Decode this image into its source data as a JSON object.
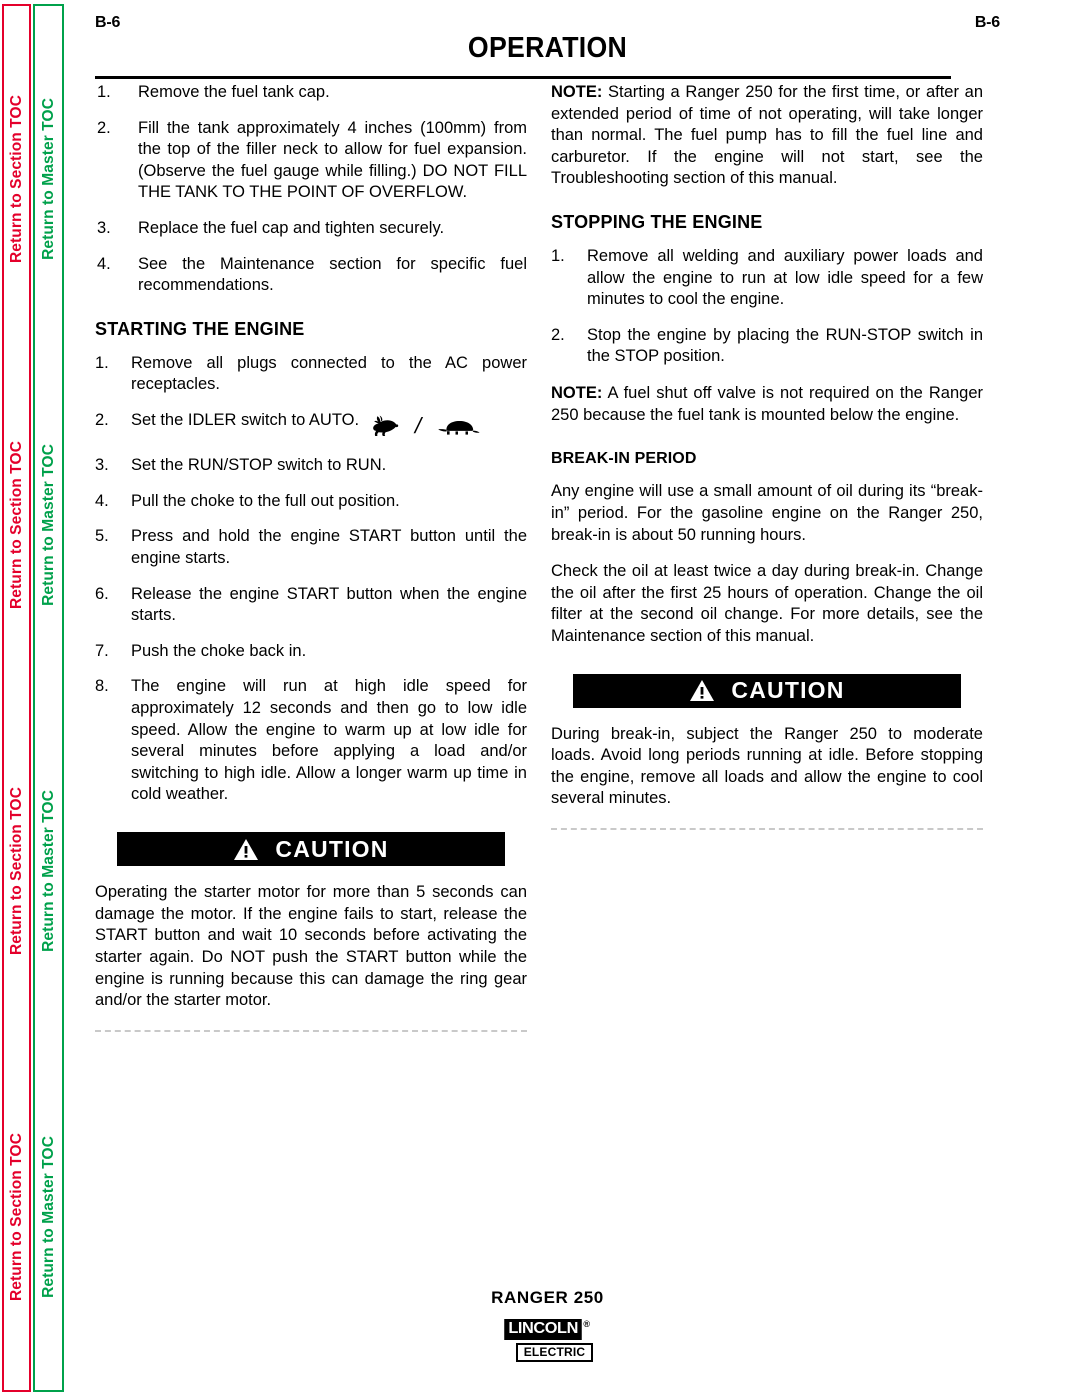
{
  "sidebar": {
    "section_toc_label": "Return to Section TOC",
    "master_toc_label": "Return to Master TOC",
    "repeat_count": 4,
    "section_color": "#e4002b",
    "master_color": "#00a14b"
  },
  "header": {
    "folio_left": "B-6",
    "folio_right": "B-6",
    "title": "OPERATION"
  },
  "left_column": {
    "fueling_steps": [
      {
        "num": "1.",
        "text": "Remove the fuel tank cap."
      },
      {
        "num": "2.",
        "text": "Fill the tank approximately 4 inches (100mm) from the top of the filler neck to allow for fuel expansion. (Observe the fuel gauge while filling.)  DO NOT FILL THE TANK TO THE POINT OF OVERFLOW."
      },
      {
        "num": "3.",
        "text": "Replace the fuel cap and tighten securely."
      },
      {
        "num": "4.",
        "text": "See the Maintenance  section for specific fuel recommendations."
      }
    ],
    "starting_heading": "STARTING THE ENGINE",
    "starting_steps": [
      {
        "num": "1.",
        "text": "Remove all plugs connected to the AC power receptacles."
      },
      {
        "num": "2.",
        "text": "Set the IDLER switch to AUTO.",
        "icons": [
          "rabbit-icon",
          "turtle-icon"
        ],
        "icon_separator": "/"
      },
      {
        "num": "3.",
        "text": "Set the RUN/STOP switch to RUN."
      },
      {
        "num": "4.",
        "text": "Pull the choke to the full out position."
      },
      {
        "num": "5.",
        "text": "Press and hold the engine START button until the engine starts."
      },
      {
        "num": "6.",
        "text": "Release the engine START button when the engine starts."
      },
      {
        "num": "7.",
        "text": "Push the choke back in."
      },
      {
        "num": "8.",
        "text": "The engine will run at high idle speed for approximately 12 seconds and then go to low idle speed. Allow the engine to warm up at low idle for several minutes before applying a load and/or switching to high idle.  Allow a longer warm up time in cold weather."
      }
    ],
    "caution": {
      "label": "CAUTION",
      "icon": "warning-triangle-icon",
      "body": "Operating the starter motor for more than 5 seconds can damage the motor.  If the engine fails to start, release the START button and wait 10 seconds before activating the starter again.  Do NOT push the START button while the engine is running because this can damage the ring gear and/or the starter motor."
    }
  },
  "right_column": {
    "note_starting_label": "NOTE:",
    "note_starting_text": " Starting a Ranger 250 for the first time, or after an extended period of time of not operating, will take longer than normal.  The fuel pump has to fill the fuel line and carburetor.  If the engine will not start, see the Troubleshooting   section of this manual.",
    "stopping_heading": "STOPPING THE ENGINE",
    "stopping_steps": [
      {
        "num": "1.",
        "text": "Remove all welding and auxiliary power loads and allow the engine to run at low idle speed for a few minutes to cool the engine."
      },
      {
        "num": "2.",
        "text": "Stop the engine by placing the RUN-STOP switch in the STOP position."
      }
    ],
    "note_fuel_label": "NOTE:",
    "note_fuel_text": " A fuel shut off valve is not required on the Ranger 250 because the fuel tank is mounted below the engine.",
    "breakin_heading": "BREAK-IN PERIOD",
    "breakin_p1": "Any engine will use a small amount of oil during its “break-in” period.  For the gasoline engine on the Ranger 250, break-in is about 50 running hours.",
    "breakin_p2": "Check the oil at least twice a day during break-in. Change the oil after the first 25 hours of operation. Change the oil filter at the second oil change.  For more details, see the Maintenance  section of this manual.",
    "caution": {
      "label": "CAUTION",
      "icon": "warning-triangle-icon",
      "body": "During break-in, subject the Ranger 250 to moderate loads.  Avoid long periods running at idle.  Before stopping the engine, remove all loads and allow the engine to cool several minutes."
    }
  },
  "footer": {
    "model": "RANGER  250",
    "logo_primary": "LINCOLN",
    "logo_registered": "®",
    "logo_secondary": "ELECTRIC"
  }
}
